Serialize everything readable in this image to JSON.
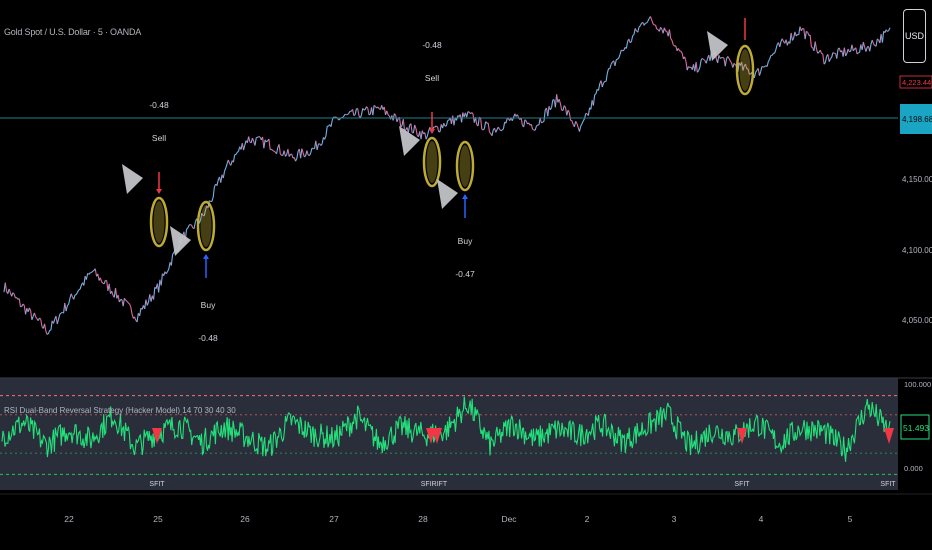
{
  "header": {
    "symbol_title": "Gold Spot / U.S. Dollar · 5 · OANDA",
    "currency_button": "USD"
  },
  "price_axis": {
    "ticks": [
      "4,150.000",
      "4,100.000",
      "4,050.000"
    ],
    "last_price": "4,198.685",
    "high_marker": "4,223.440"
  },
  "time_axis": {
    "labels": [
      "22",
      "25",
      "26",
      "27",
      "28",
      "Dec",
      "2",
      "3",
      "4",
      "5"
    ]
  },
  "annotations": {
    "trades": [
      {
        "value": "-0.48",
        "action": "Sell"
      },
      {
        "value": "-0.48",
        "action": "Buy"
      },
      {
        "value": "-0.48",
        "action": "Sell"
      },
      {
        "value": "-0.47",
        "action": "Buy"
      }
    ]
  },
  "indicator": {
    "title": "RSI Dual-Band Reversal Strategy (Hacker Model) 14 70 30 40 30",
    "value": "51.493",
    "top_tick": "100.000",
    "bottom_tick": "0.000",
    "markers": [
      "SFIT",
      "SFIRIFT",
      "SFIT",
      "SFIT"
    ]
  },
  "colors": {
    "background": "#000000",
    "rsi_line": "#22e07a",
    "sell": "#f23645",
    "buy": "#2962ff",
    "highlight": "#c8b437",
    "last_price_line": "#1e7f8e",
    "last_price_tag": "#1aa5c4",
    "pane_bg": "#2a2d3a"
  },
  "chart_data": {
    "type": "line",
    "title": "Gold Spot / U.S. Dollar · 5 · OANDA",
    "xlabel": "",
    "ylabel": "",
    "ylim": [
      4020,
      4235
    ],
    "x_labels": [
      "22",
      "25",
      "26",
      "27",
      "28",
      "Dec",
      "2",
      "3",
      "4",
      "5"
    ],
    "series": [
      {
        "x": [
          0.0,
          0.025,
          0.05,
          0.075,
          0.1,
          0.125,
          0.15,
          0.175,
          0.2,
          0.225,
          0.25,
          0.275,
          0.3,
          0.325,
          0.35,
          0.375,
          0.4,
          0.425,
          0.45,
          0.475,
          0.5,
          0.525,
          0.55,
          0.575,
          0.6,
          0.625,
          0.65,
          0.675,
          0.7,
          0.725,
          0.75,
          0.775,
          0.8,
          0.825,
          0.85,
          0.875,
          0.9,
          0.925,
          0.95,
          0.975,
          1.0
        ],
        "values": [
          4070,
          4056,
          4043,
          4062,
          4079,
          4066,
          4052,
          4070,
          4098,
          4112,
          4140,
          4158,
          4155,
          4147,
          4152,
          4170,
          4173,
          4176,
          4167,
          4160,
          4168,
          4172,
          4163,
          4170,
          4166,
          4182,
          4162,
          4192,
          4212,
          4230,
          4222,
          4198,
          4208,
          4202,
          4197,
          4213,
          4224,
          4206,
          4210,
          4213,
          4222
        ]
      }
    ],
    "rsi_series": {
      "name": "RSI",
      "ylim": [
        0,
        100
      ],
      "bands": [
        30,
        70
      ],
      "values": [
        48,
        62,
        38,
        55,
        44,
        70,
        36,
        52,
        60,
        41,
        58,
        47,
        35,
        64,
        50,
        45,
        68,
        40,
        57,
        49,
        53,
        82,
        38,
        61,
        44,
        55,
        49,
        60,
        42,
        57,
        71,
        36,
        54,
        48,
        62,
        40,
        57,
        53,
        34,
        80,
        51
      ]
    }
  }
}
